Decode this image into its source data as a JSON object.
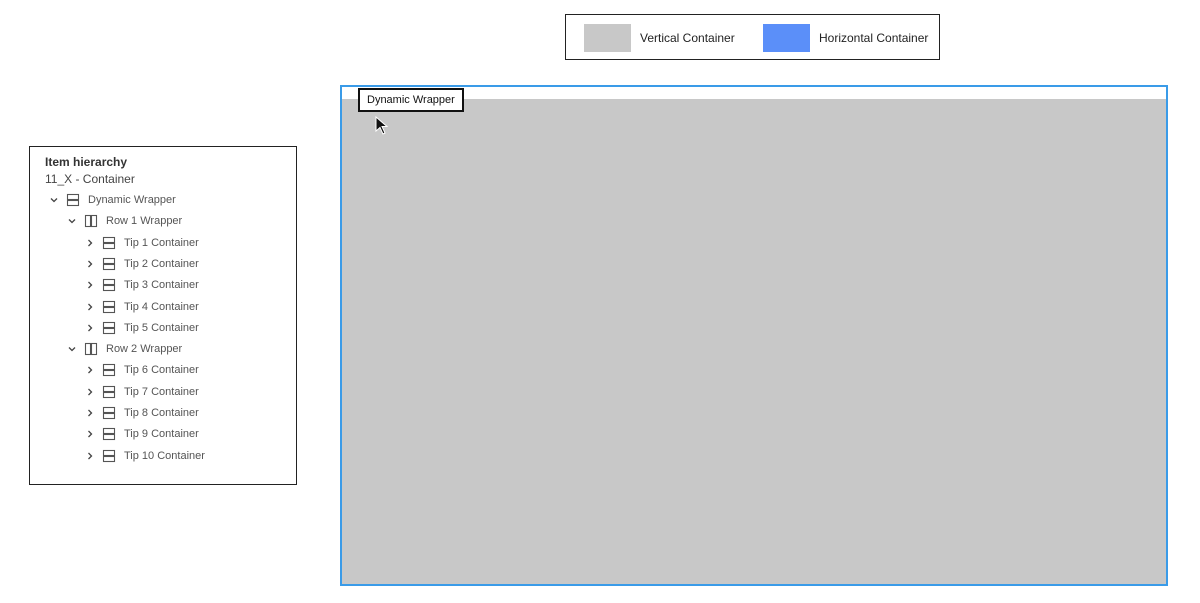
{
  "legend": {
    "items": [
      {
        "label": "Vertical Container",
        "color": "#c8c8c8"
      },
      {
        "label": "Horizontal Container",
        "color": "#5b8ff9"
      }
    ]
  },
  "hierarchy": {
    "title": "Item hierarchy",
    "subtitle": "11_X - Container",
    "nodes": [
      {
        "label": "Dynamic Wrapper",
        "chevron": "chevron-down-icon",
        "icon": "vertical-container-icon"
      },
      {
        "label": "Row 1 Wrapper",
        "chevron": "chevron-down-icon",
        "icon": "horizontal-container-icon"
      },
      {
        "label": "Tip 1 Container",
        "chevron": "chevron-right-icon",
        "icon": "vertical-container-icon"
      },
      {
        "label": "Tip 2 Container",
        "chevron": "chevron-right-icon",
        "icon": "vertical-container-icon"
      },
      {
        "label": "Tip 3 Container",
        "chevron": "chevron-right-icon",
        "icon": "vertical-container-icon"
      },
      {
        "label": "Tip 4 Container",
        "chevron": "chevron-right-icon",
        "icon": "vertical-container-icon"
      },
      {
        "label": "Tip 5 Container",
        "chevron": "chevron-right-icon",
        "icon": "vertical-container-icon"
      },
      {
        "label": "Row 2 Wrapper",
        "chevron": "chevron-down-icon",
        "icon": "horizontal-container-icon"
      },
      {
        "label": "Tip 6 Container",
        "chevron": "chevron-right-icon",
        "icon": "vertical-container-icon"
      },
      {
        "label": "Tip 7 Container",
        "chevron": "chevron-right-icon",
        "icon": "vertical-container-icon"
      },
      {
        "label": "Tip 8 Container",
        "chevron": "chevron-right-icon",
        "icon": "vertical-container-icon"
      },
      {
        "label": "Tip 9 Container",
        "chevron": "chevron-right-icon",
        "icon": "vertical-container-icon"
      },
      {
        "label": "Tip 10 Container",
        "chevron": "chevron-right-icon",
        "icon": "vertical-container-icon"
      }
    ]
  },
  "canvas": {
    "label": "Dynamic Wrapper",
    "selection_color": "#3a9be8",
    "fill_color": "#c8c8c8"
  },
  "cursor": {
    "icon": "mouse-pointer-icon"
  }
}
